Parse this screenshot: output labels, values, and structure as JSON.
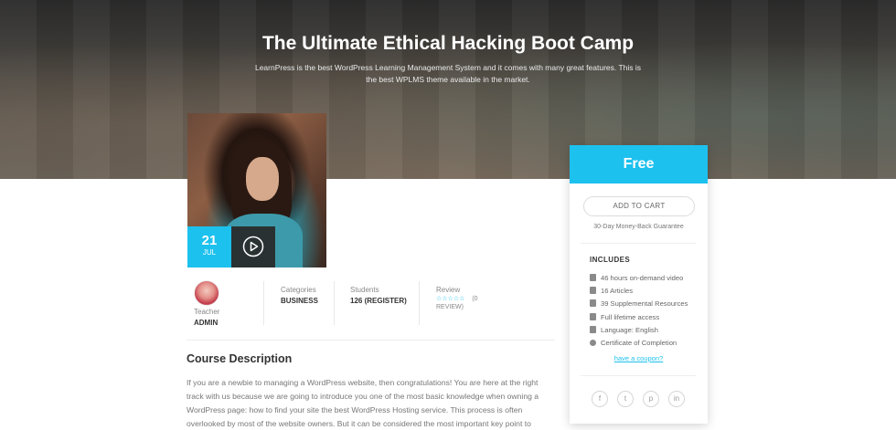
{
  "hero": {
    "title": "The Ultimate Ethical Hacking Boot Camp",
    "subtitle": "LearnPress is the best WordPress Learning Management System and it comes with many great features. This is the best WPLMS theme available in the market."
  },
  "thumbnail": {
    "date_day": "21",
    "date_month": "JUL"
  },
  "meta": {
    "teacher_label": "Teacher",
    "teacher_value": "ADMIN",
    "categories_label": "Categories",
    "categories_value": "BUSINESS",
    "students_label": "Students",
    "students_value": "126 (REGISTER)",
    "review_label": "Review",
    "review_stars": "☆☆☆☆☆",
    "review_count": "(0",
    "review_count_suffix": "REVIEW)"
  },
  "description": {
    "title": "Course Description",
    "text": "If you are a newbie to managing a WordPress website, then congratulations! You are here at the right track with us because we are going to introduce you one of the most basic knowledge when owning a WordPress page: how to find your site the best WordPress Hosting service. This process is often overlooked by most of the website owners. But it can be considered the most important key point to"
  },
  "sidebar": {
    "price": "Free",
    "add_to_cart": "ADD TO CART",
    "guarantee": "30-Day Money-Back Guarantee",
    "includes_title": "INCLUDES",
    "includes": [
      "46 hours on-demand video",
      "16 Articles",
      "39 Supplemental Resources",
      "Full lifetime access",
      "Language: English",
      "Certificate of Completion"
    ],
    "coupon": "have a coupon?",
    "socials": [
      "f",
      "t",
      "p",
      "in"
    ]
  },
  "colors": {
    "accent": "#1dc1ee",
    "dark_box": "#282828"
  }
}
